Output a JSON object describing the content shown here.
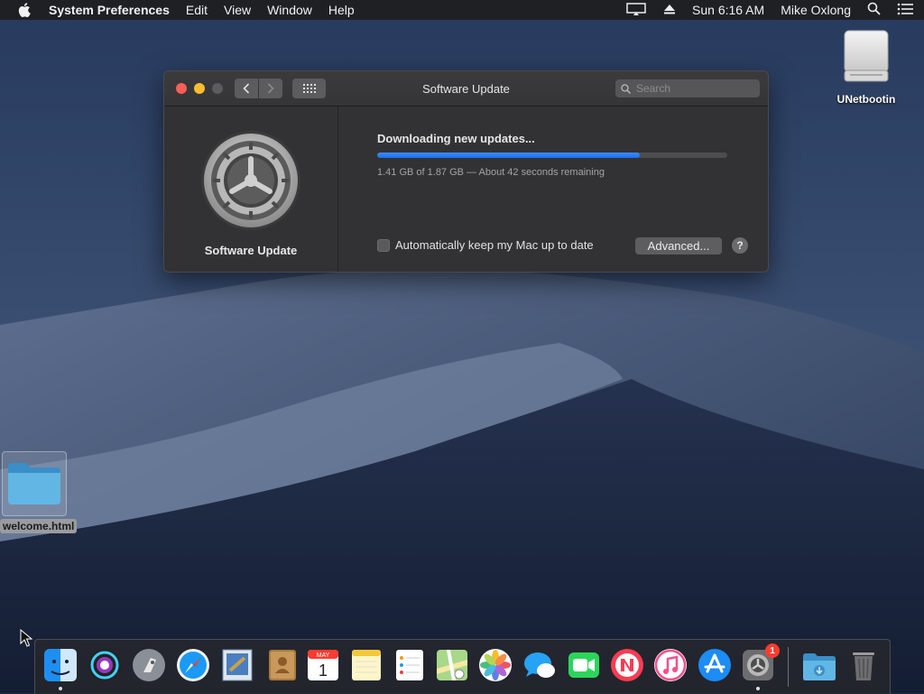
{
  "menubar": {
    "app_name": "System Preferences",
    "menus": [
      "Edit",
      "View",
      "Window",
      "Help"
    ],
    "clock": "Sun 6:16 AM",
    "user": "Mike Oxlong"
  },
  "window": {
    "title": "Software Update",
    "search_placeholder": "Search",
    "sidebar_label": "Software Update",
    "download_title": "Downloading new updates...",
    "progress_fraction": 0.75,
    "download_status": "1.41 GB of 1.87 GB — About 42 seconds remaining",
    "auto_update_label": "Automatically keep my Mac up to date",
    "auto_update_checked": false,
    "advanced_button": "Advanced...",
    "help_button": "?"
  },
  "desktop": {
    "drive_label": "UNetbootin",
    "folder_label": "welcome.html"
  },
  "dock": {
    "items": [
      {
        "name": "finder-icon"
      },
      {
        "name": "siri-icon"
      },
      {
        "name": "launchpad-icon"
      },
      {
        "name": "safari-icon"
      },
      {
        "name": "mail-icon"
      },
      {
        "name": "contacts-icon"
      },
      {
        "name": "calendar-icon",
        "month": "MAY",
        "day": "1"
      },
      {
        "name": "notes-icon"
      },
      {
        "name": "reminders-icon"
      },
      {
        "name": "maps-icon"
      },
      {
        "name": "photos-icon"
      },
      {
        "name": "messages-icon"
      },
      {
        "name": "facetime-icon"
      },
      {
        "name": "news-icon"
      },
      {
        "name": "itunes-icon"
      },
      {
        "name": "app-store-icon"
      },
      {
        "name": "system-preferences-icon",
        "badge": "1"
      }
    ],
    "calendar_month": "MAY",
    "calendar_day": "1",
    "sysprefs_badge": "1"
  },
  "colors": {
    "accent": "#1f6fe8",
    "window_bg": "#323234",
    "close": "#fe5f57",
    "minimize": "#febc2e"
  }
}
